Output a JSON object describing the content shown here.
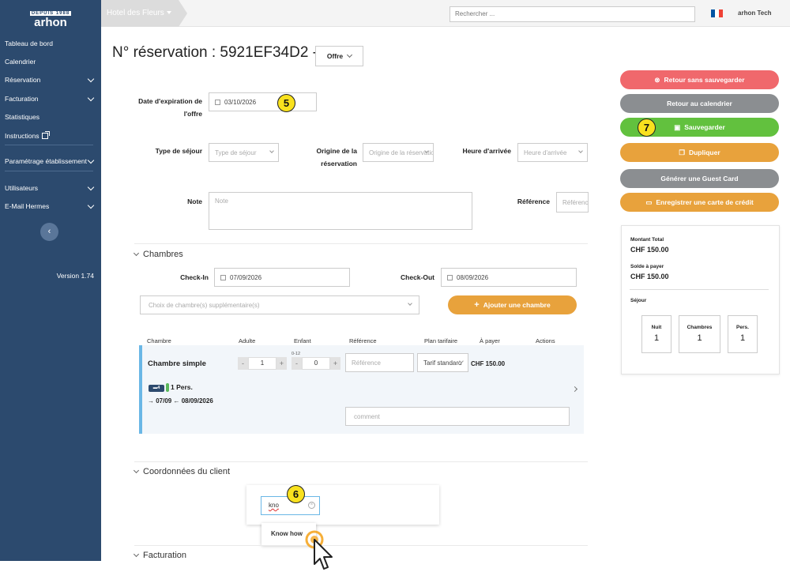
{
  "app": {
    "logo_top": "DEPUIS 1988",
    "logo_name": "arhon",
    "version": "Version 1.74"
  },
  "sidebar": {
    "items": [
      {
        "label": "Tableau de bord",
        "has_chevron": false
      },
      {
        "label": "Calendrier",
        "has_chevron": false
      },
      {
        "label": "Réservation",
        "has_chevron": true
      },
      {
        "label": "Facturation",
        "has_chevron": true
      },
      {
        "label": "Statistiques",
        "has_chevron": false
      },
      {
        "label": "Instructions",
        "has_chevron": false
      },
      {
        "label": "Paramétrage établissement",
        "has_chevron": true
      },
      {
        "label": "Utilisateurs",
        "has_chevron": true
      },
      {
        "label": "E-Mail Hermes",
        "has_chevron": true
      }
    ],
    "collapse_glyph": "‹"
  },
  "topbar": {
    "hotel": "Hotel des Fleurs",
    "search_placeholder": "Rechercher ...",
    "user": "arhon Tech",
    "flag_colors": [
      "#0055a4",
      "#ffffff",
      "#ef4135"
    ]
  },
  "header": {
    "title": "N° réservation : 5921EF34D2 -",
    "status": "Offre"
  },
  "form": {
    "expiration": {
      "label_line1": "Date d'expiration de",
      "label_line2": "l'offre",
      "value": "03/10/2026"
    },
    "type_sejour": {
      "label": "Type de séjour",
      "placeholder": "Type de séjour"
    },
    "origine": {
      "label_line1": "Origine de la",
      "label_line2": "réservation",
      "placeholder": "Origine de la réservation"
    },
    "heure": {
      "label": "Heure d'arrivée",
      "placeholder": "Heure d'arrivée"
    },
    "note": {
      "label": "Note",
      "placeholder": "Note"
    },
    "reference": {
      "label": "Référence",
      "placeholder": "Référence"
    }
  },
  "chambres": {
    "title": "Chambres",
    "checkin_label": "Check-In",
    "checkin": "07/09/2026",
    "checkout_label": "Check-Out",
    "checkout": "08/09/2026",
    "room_choice_placeholder": "Choix de chambre(s) supplémentaire(s)",
    "add_button": "Ajouter une chambre",
    "columns": [
      "Chambre",
      "Adulte",
      "Enfant",
      "Référence",
      "Plan tarifaire",
      "À payer",
      "Actions"
    ],
    "row": {
      "name": "Chambre simple",
      "adults": "1",
      "children": "0",
      "child_age": "0-12",
      "reference_placeholder": "Référence",
      "tarif": "Tarif standard",
      "price": "CHF 150.00",
      "beds": "4",
      "persons": "1 Pers.",
      "dates": "07/09",
      "dates_end": "08/09/2026",
      "comment_placeholder": "comment"
    }
  },
  "client": {
    "title": "Coordonnées du client",
    "typed": "kno",
    "suggestion": "Know how"
  },
  "facturation": {
    "title": "Facturation"
  },
  "actions": {
    "cancel": {
      "label": "Retour sans sauvegarder",
      "color": "#f0686c"
    },
    "back": {
      "label": "Retour au calendrier",
      "color": "#8b8e91"
    },
    "save": {
      "label": "Sauvegarder",
      "color": "#62c13e"
    },
    "duplicate": {
      "label": "Dupliquer",
      "color": "#e8a23c"
    },
    "guest_card": {
      "label": "Générer une Guest Card",
      "color": "#8b8e91"
    },
    "credit_card": {
      "label": "Enregistrer une carte de crédit",
      "color": "#e8a23c"
    }
  },
  "summary": {
    "total_label": "Montant Total",
    "total": "CHF 150.00",
    "balance_label": "Solde à payer",
    "balance": "CHF 150.00",
    "stay_label": "Séjour",
    "stats": [
      {
        "label": "Nuit",
        "value": "1"
      },
      {
        "label": "Chambres",
        "value": "1"
      },
      {
        "label": "Pers.",
        "value": "1"
      }
    ]
  },
  "markers": [
    "5",
    "6",
    "7"
  ]
}
